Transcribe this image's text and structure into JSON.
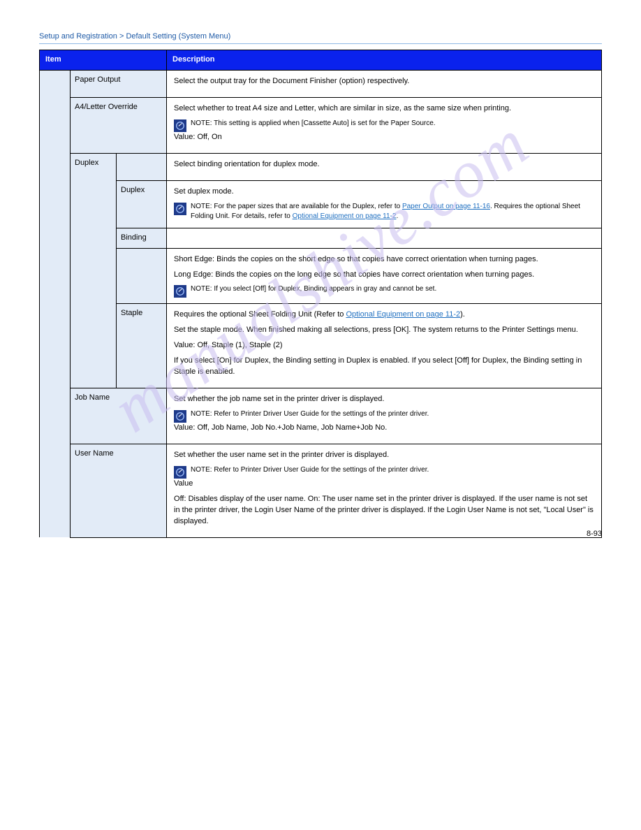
{
  "watermark": "manualshive.com",
  "header": {
    "breadcrumb": "Setup and Registration > Default Setting (System Menu)"
  },
  "footer": {
    "page": "8-93"
  },
  "table": {
    "header": {
      "item": "Item",
      "description": "Description"
    },
    "rows": {
      "paper_output": {
        "label": "Paper Output",
        "description": "Select the output tray for the Document Finisher (option) respectively."
      },
      "a4_letter": {
        "label": "A4/Letter Override",
        "description": "Select whether to treat A4 size and Letter, which are similar in size, as the same size when printing.",
        "note": "NOTE: This setting is applied when [Cassette Auto] is set for the Paper Source.",
        "values": "Value: Off, On"
      },
      "duplex": {
        "label": "Duplex",
        "description": "Select binding orientation for duplex mode.",
        "sub": {
          "duplex": {
            "label": "Duplex",
            "description": "Set duplex mode.",
            "note_prefix": "NOTE: For the paper sizes that are available for the Duplex, refer to ",
            "note_link": "Paper Output on page 11-16",
            "note_suffix1": " Requires the optional Sheet Folding Unit. For details, refer to ",
            "note_link2": "Optional Equipment on page 11-2"
          },
          "binding": {
            "label": "Binding",
            "short_edge": "Short Edge: Binds the copies on the short edge so that copies have correct orientation when turning pages.",
            "long_edge": "Long Edge: Binds the copies on the long edge so that copies have correct orientation when turning pages.",
            "note": "NOTE: If you select [Off] for Duplex, Binding appears in gray and cannot be set."
          },
          "staple": {
            "label": "Staple",
            "desc_prefix": "Requires the optional Sheet Folding Unit (Refer to ",
            "link": "Optional Equipment on page 11-2",
            "description2": "Set the staple mode. When finished making all selections, press [OK]. The system returns to the Printer Settings menu.",
            "values": "Value: Off, Staple (1), Staple (2)",
            "description3": "If you select [On] for Duplex, the Binding setting in Duplex is enabled. If you select [Off] for Duplex, the Binding setting in Staple is enabled."
          }
        }
      },
      "job_name": {
        "label": "Job Name",
        "description": "Set whether the job name set in the printer driver is displayed.",
        "note": "NOTE: Refer to Printer Driver User Guide for the settings of the printer driver.",
        "values": "Value: Off, Job Name, Job No.+Job Name, Job Name+Job No."
      },
      "user_name": {
        "label": "User Name",
        "description": "Set whether the user name set in the printer driver is displayed.",
        "note": "NOTE: Refer to Printer Driver User Guide for the settings of the printer driver.",
        "description2": "Value",
        "description3": "Off: Disables display of the user name.\nOn: The user name set in the printer driver is displayed. If the user name is not set in the printer driver, the Login User Name of the printer driver is displayed. If the Login User Name is not set, \"Local User\" is displayed."
      }
    }
  }
}
